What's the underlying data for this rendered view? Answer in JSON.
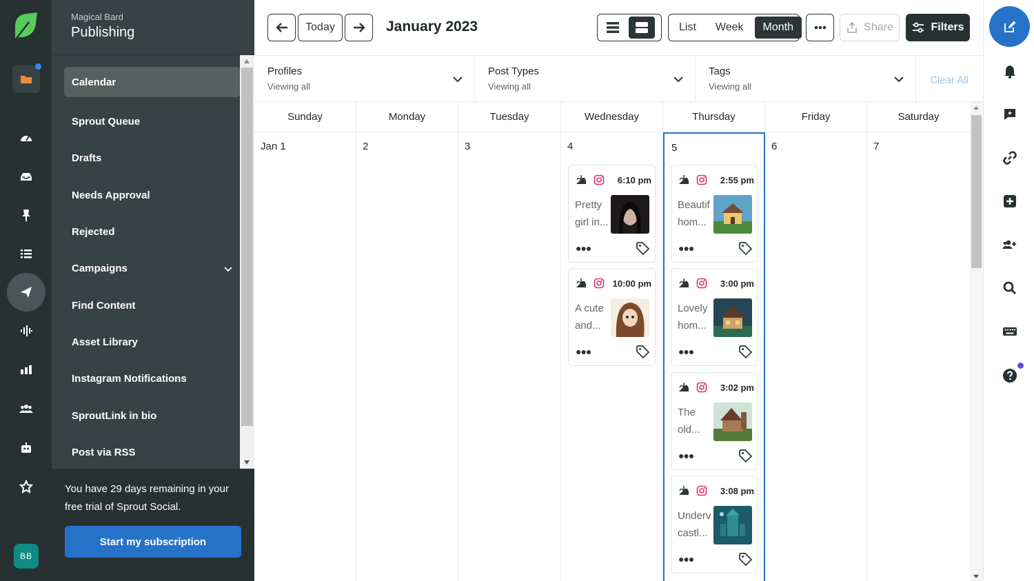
{
  "nav": {
    "company": "Magical Bard",
    "title": "Publishing",
    "items": [
      {
        "label": "Calendar"
      },
      {
        "label": "Sprout Queue"
      },
      {
        "label": "Drafts"
      },
      {
        "label": "Needs Approval"
      },
      {
        "label": "Rejected"
      },
      {
        "label": "Campaigns"
      },
      {
        "label": "Find Content"
      },
      {
        "label": "Asset Library"
      },
      {
        "label": "Instagram Notifications"
      },
      {
        "label": "SproutLink in bio"
      },
      {
        "label": "Post via RSS"
      }
    ],
    "trial_text": "You have 29 days remaining in your free trial of Sprout Social.",
    "trial_button": "Start my subscription",
    "avatar": "BB"
  },
  "toolbar": {
    "today": "Today",
    "month_title": "January 2023",
    "views": [
      "List",
      "Week",
      "Month"
    ],
    "selected_view": "Month",
    "share": "Share",
    "filters": "Filters"
  },
  "filters": {
    "profiles": {
      "label": "Profiles",
      "value": "Viewing all"
    },
    "post_types": {
      "label": "Post Types",
      "value": "Viewing all"
    },
    "tags": {
      "label": "Tags",
      "value": "Viewing all"
    },
    "clear_all": "Clear All"
  },
  "calendar": {
    "days": [
      "Sunday",
      "Monday",
      "Tuesday",
      "Wednesday",
      "Thursday",
      "Friday",
      "Saturday"
    ],
    "dates": [
      "Jan 1",
      "2",
      "3",
      "4",
      "5",
      "6",
      "7"
    ],
    "wednesday_posts": [
      {
        "time": "6:10 pm",
        "text_line1": "Pretty",
        "text_line2": "girl in...",
        "thumb": "portrait-dark-hair"
      },
      {
        "time": "10:00 pm",
        "text_line1": "A cute",
        "text_line2": "and...",
        "thumb": "anime-girl"
      }
    ],
    "thursday_posts": [
      {
        "time": "2:55 pm",
        "text_line1": "Beautif",
        "text_line2": "hom...",
        "thumb": "cottage-yellow"
      },
      {
        "time": "3:00 pm",
        "text_line1": "Lovely",
        "text_line2": "hom...",
        "thumb": "cottage-blue"
      },
      {
        "time": "3:02 pm",
        "text_line1": "The",
        "text_line2": "old...",
        "thumb": "cottage-green"
      },
      {
        "time": "3:08 pm",
        "text_line1": "Underv",
        "text_line2": "castl...",
        "thumb": "underwater-castle"
      }
    ]
  },
  "colors": {
    "accent": "#2772c9",
    "sidebar": "#364244",
    "rail": "#273132",
    "instagram": "#e1306c"
  }
}
